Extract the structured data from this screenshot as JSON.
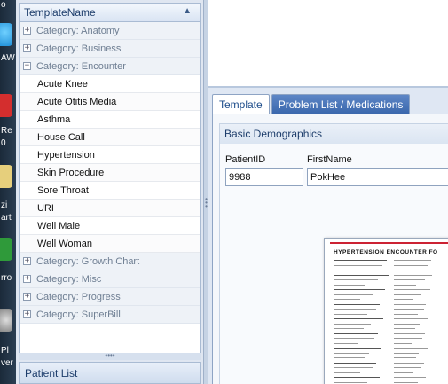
{
  "desktop": {
    "labels": [
      "o",
      "AW",
      "Re",
      "0",
      "zi",
      "art",
      "rro",
      "Pl",
      "ver"
    ],
    "icon_colors": [
      "#1f8fd8",
      "#d42e2e",
      "#e6cf7c",
      "#2f9a3a",
      "#bbbbbb"
    ]
  },
  "template_tree": {
    "column_header": "TemplateName",
    "sort_indicator": "▲",
    "categories_before": [
      {
        "label": "Category: Anatomy",
        "expander": "+"
      },
      {
        "label": "Category: Business",
        "expander": "+"
      }
    ],
    "expanded_category": {
      "label": "Category: Encounter",
      "expander": "−"
    },
    "encounter_items": [
      "Acute Knee",
      "Acute Otitis Media",
      "Asthma",
      "House Call",
      "Hypertension",
      "Skin Procedure",
      "Sore Throat",
      "URI",
      "Well Male",
      "Well Woman"
    ],
    "categories_after": [
      {
        "label": "Category: Growth Chart",
        "expander": "+"
      },
      {
        "label": "Category: Misc",
        "expander": "+"
      },
      {
        "label": "Category: Progress",
        "expander": "+"
      },
      {
        "label": "Category: SuperBill",
        "expander": "+"
      }
    ],
    "splitter_dots": "••••"
  },
  "patient_list": {
    "label": "Patient List"
  },
  "right_pane": {
    "tabs": [
      {
        "label": "Template",
        "active": true
      },
      {
        "label": "Problem List / Medications",
        "active": false
      }
    ],
    "group_title": "Basic Demographics",
    "patient_id": {
      "label": "PatientID",
      "value": "9988"
    },
    "first_name": {
      "label": "FirstName",
      "value": "PokHee"
    },
    "document_preview": {
      "title": "HYPERTENSION ENCOUNTER FO"
    }
  },
  "colors": {
    "tab_active_text": "#1d4c8a",
    "tab_inactive_bg": "#3b68ad",
    "header_text": "#1d3d6b",
    "doc_red_bar": "#cc2233"
  }
}
